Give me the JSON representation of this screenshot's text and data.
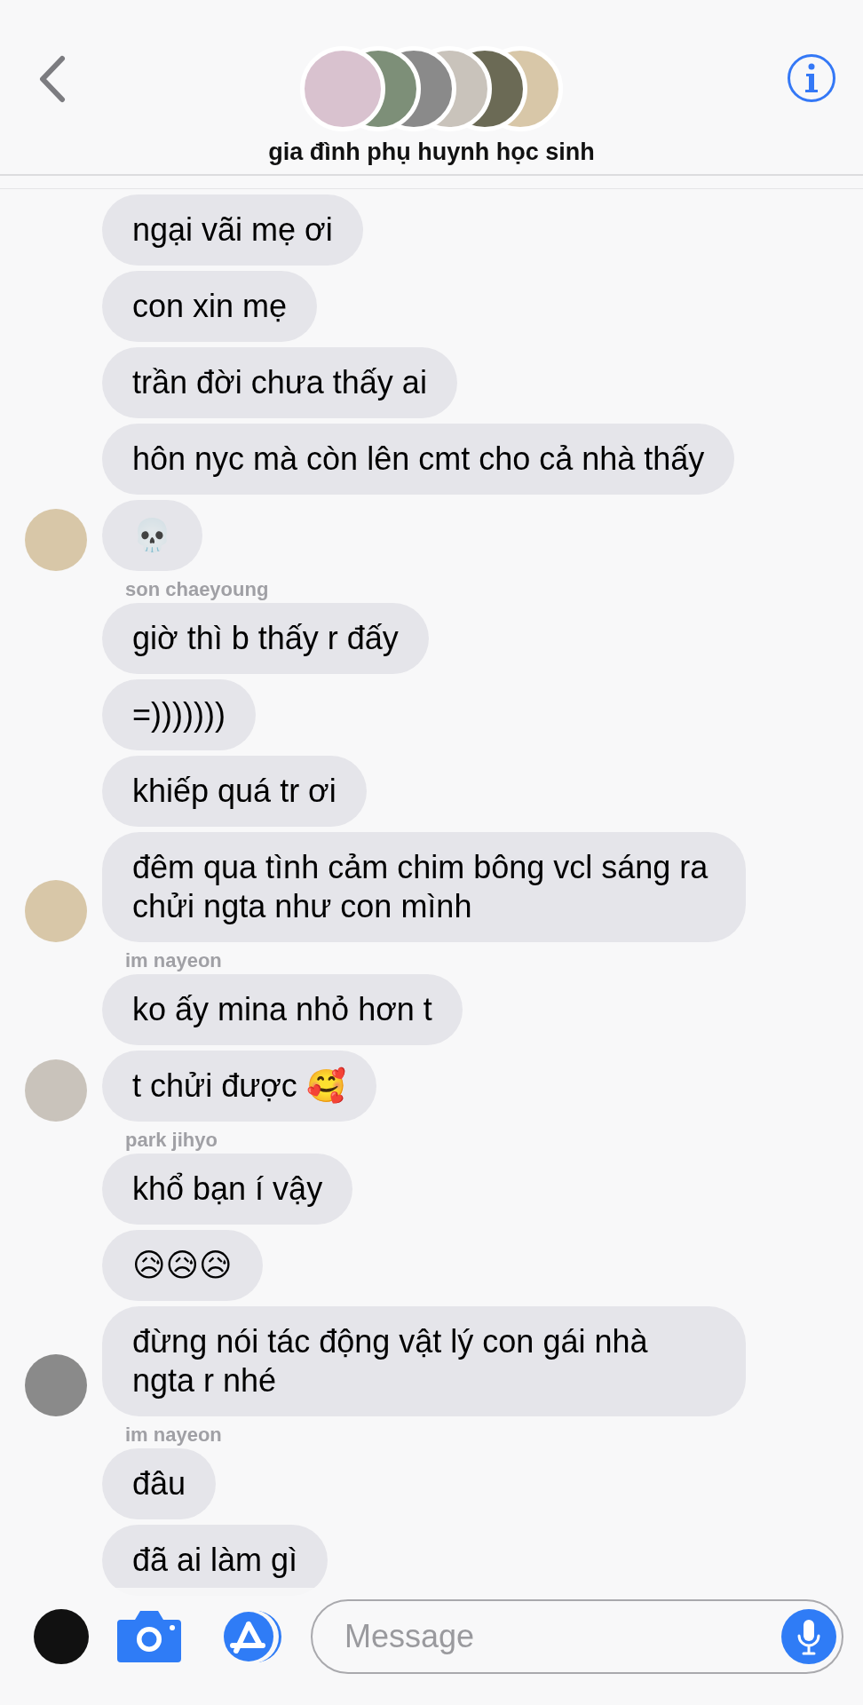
{
  "header": {
    "title": "gia đình phụ huynh học sinh"
  },
  "messages": [
    {
      "kind": "bubble",
      "text": "ngại vãi mẹ ơi",
      "avatar": false
    },
    {
      "kind": "bubble",
      "text": "con xin mẹ",
      "avatar": false
    },
    {
      "kind": "bubble",
      "text": "trần đời chưa thấy ai",
      "avatar": false
    },
    {
      "kind": "bubble",
      "text": "hôn nyc mà còn lên cmt cho cả nhà thấy",
      "avatar": false
    },
    {
      "kind": "bubble",
      "text": "💀",
      "avatar": true
    },
    {
      "kind": "sender",
      "text": "son chaeyoung"
    },
    {
      "kind": "bubble",
      "text": "giờ thì b thấy r đấy",
      "avatar": false
    },
    {
      "kind": "bubble",
      "text": "=)))))))",
      "avatar": false
    },
    {
      "kind": "bubble",
      "text": "khiếp quá tr ơi",
      "avatar": false
    },
    {
      "kind": "bubble",
      "text": "đêm qua tình cảm chim bông vcl sáng ra chửi ngta như con mình",
      "avatar": true
    },
    {
      "kind": "sender",
      "text": "im nayeon"
    },
    {
      "kind": "bubble",
      "text": "ko ấy mina nhỏ hơn t",
      "avatar": false
    },
    {
      "kind": "bubble",
      "text": "t chửi được 🥰",
      "avatar": true
    },
    {
      "kind": "sender",
      "text": "park jihyo"
    },
    {
      "kind": "bubble",
      "text": "khổ bạn í vậy",
      "avatar": false
    },
    {
      "kind": "bubble",
      "text": "😥😥😥",
      "avatar": false
    },
    {
      "kind": "bubble",
      "text": "đừng nói tác động vật lý con gái nhà ngta r nhé",
      "avatar": true
    },
    {
      "kind": "sender",
      "text": "im nayeon"
    },
    {
      "kind": "bubble",
      "text": "đâu",
      "avatar": false
    },
    {
      "kind": "bubble",
      "text": "đã ai làm gì",
      "avatar": false
    }
  ],
  "composer": {
    "placeholder": "Message"
  }
}
